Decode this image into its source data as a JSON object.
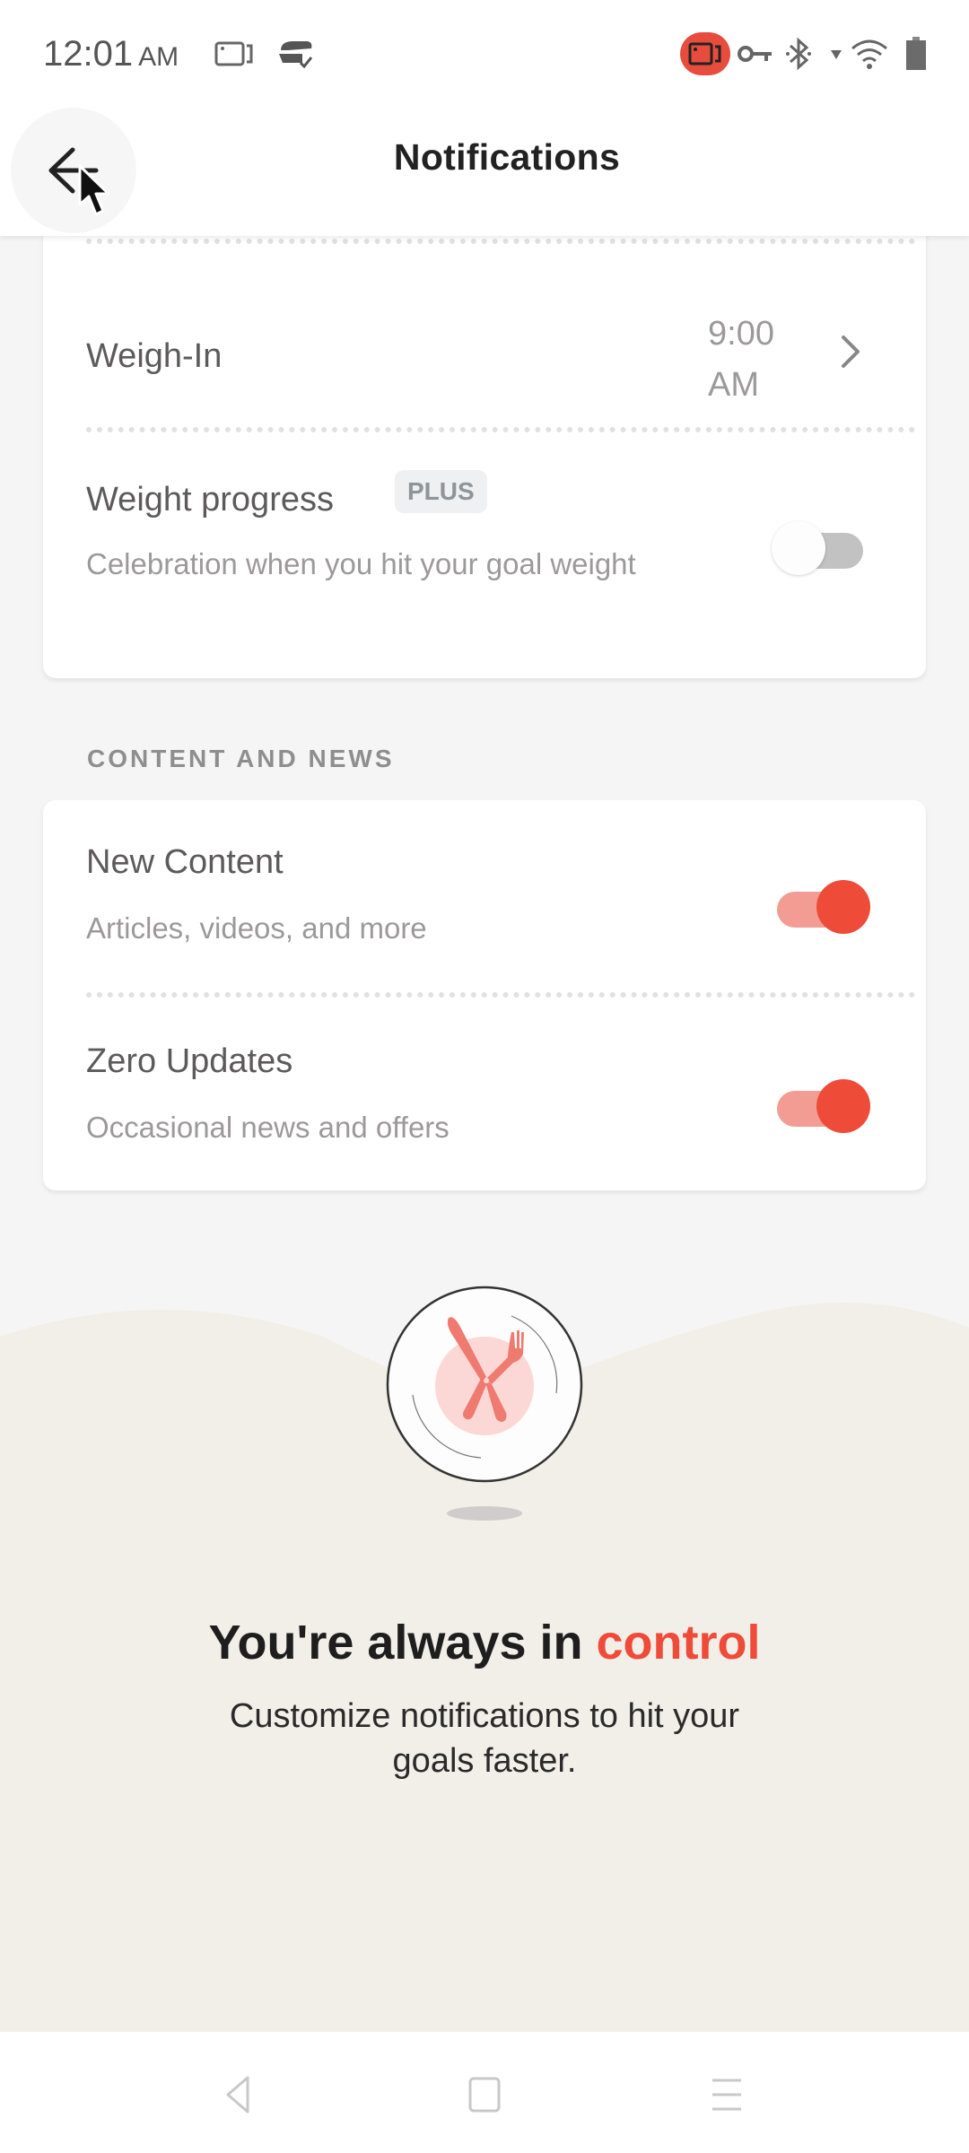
{
  "status_bar": {
    "time": "12:01",
    "ampm": "AM",
    "left_icons": [
      "screen-record-icon",
      "vpn-sync-icon"
    ],
    "right_icons": [
      "recording-active-icon",
      "vpn-key-icon",
      "bluetooth-icon",
      "signal-icon",
      "wifi-icon",
      "battery-icon"
    ],
    "recording_color": "#e74c3c"
  },
  "header": {
    "title": "Notifications",
    "back_label": "Back"
  },
  "weigh_in": {
    "title": "Weigh-In",
    "time_line1": "9:00",
    "time_line2": "AM"
  },
  "weight_progress": {
    "title": "Weight progress",
    "badge": "PLUS",
    "description": "Celebration when you hit your goal weight",
    "enabled": false
  },
  "content_section": {
    "label": "CONTENT AND NEWS",
    "items": [
      {
        "title": "New Content",
        "description": "Articles, videos, and more",
        "enabled": true
      },
      {
        "title": "Zero Updates",
        "description": "Occasional news and offers",
        "enabled": true
      }
    ]
  },
  "promo": {
    "headline_prefix": "You're always in ",
    "headline_accent": "control",
    "subtitle": "Customize notifications to hit your goals faster.",
    "accent_color": "#ee4b39"
  },
  "nav_bar": {
    "buttons": [
      "back",
      "home",
      "recents"
    ]
  }
}
